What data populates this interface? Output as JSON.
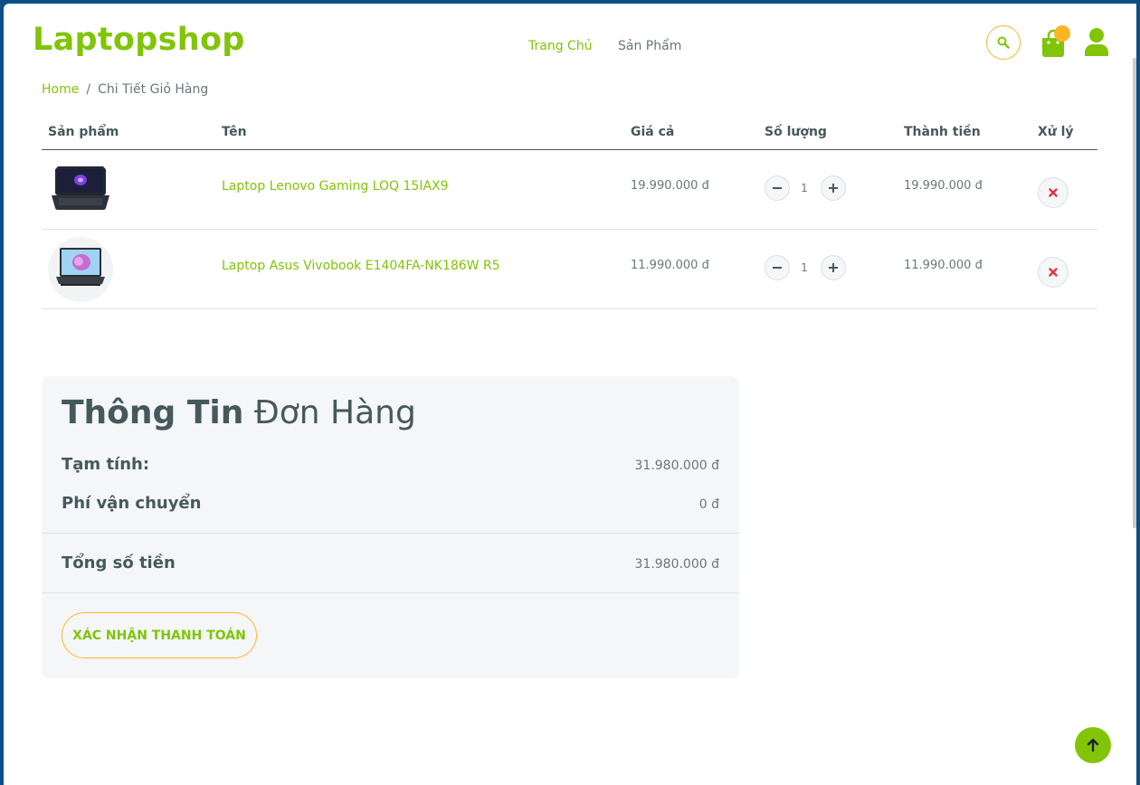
{
  "header": {
    "logo": "Laptopshop",
    "nav": [
      {
        "label": "Trang Chủ",
        "active": true
      },
      {
        "label": "Sản Phẩm",
        "active": false
      }
    ],
    "icons": [
      "search-icon",
      "shopping-bag-icon",
      "user-icon"
    ]
  },
  "breadcrumb": {
    "home": "Home",
    "separator": "/",
    "current": "Chi Tiết Giỏ Hàng"
  },
  "cart": {
    "columns": [
      "Sản phẩm",
      "Tên",
      "Giá cả",
      "Số lượng",
      "Thành tiền",
      "Xử lý"
    ],
    "items": [
      {
        "name": "Laptop Lenovo Gaming LOQ 15IAX9",
        "price": "19.990.000 đ",
        "quantity": "1",
        "total": "19.990.000 đ"
      },
      {
        "name": "Laptop Asus Vivobook E1404FA-NK186W R5",
        "price": "11.990.000 đ",
        "quantity": "1",
        "total": "11.990.000 đ"
      }
    ]
  },
  "summary": {
    "title_bold": "Thông Tin",
    "title_rest": "Đơn Hàng",
    "subtotal_label": "Tạm tính:",
    "subtotal_value": "31.980.000 đ",
    "shipping_label": "Phí vận chuyển",
    "shipping_value": "0 đ",
    "total_label": "Tổng số tiền",
    "total_value": "31.980.000 đ",
    "confirm_label": "XÁC NHẬN THANH TOÁN"
  },
  "colors": {
    "accent": "#81c408",
    "secondary": "#ffb524",
    "text": "#45595b",
    "delete": "#dc3545"
  }
}
